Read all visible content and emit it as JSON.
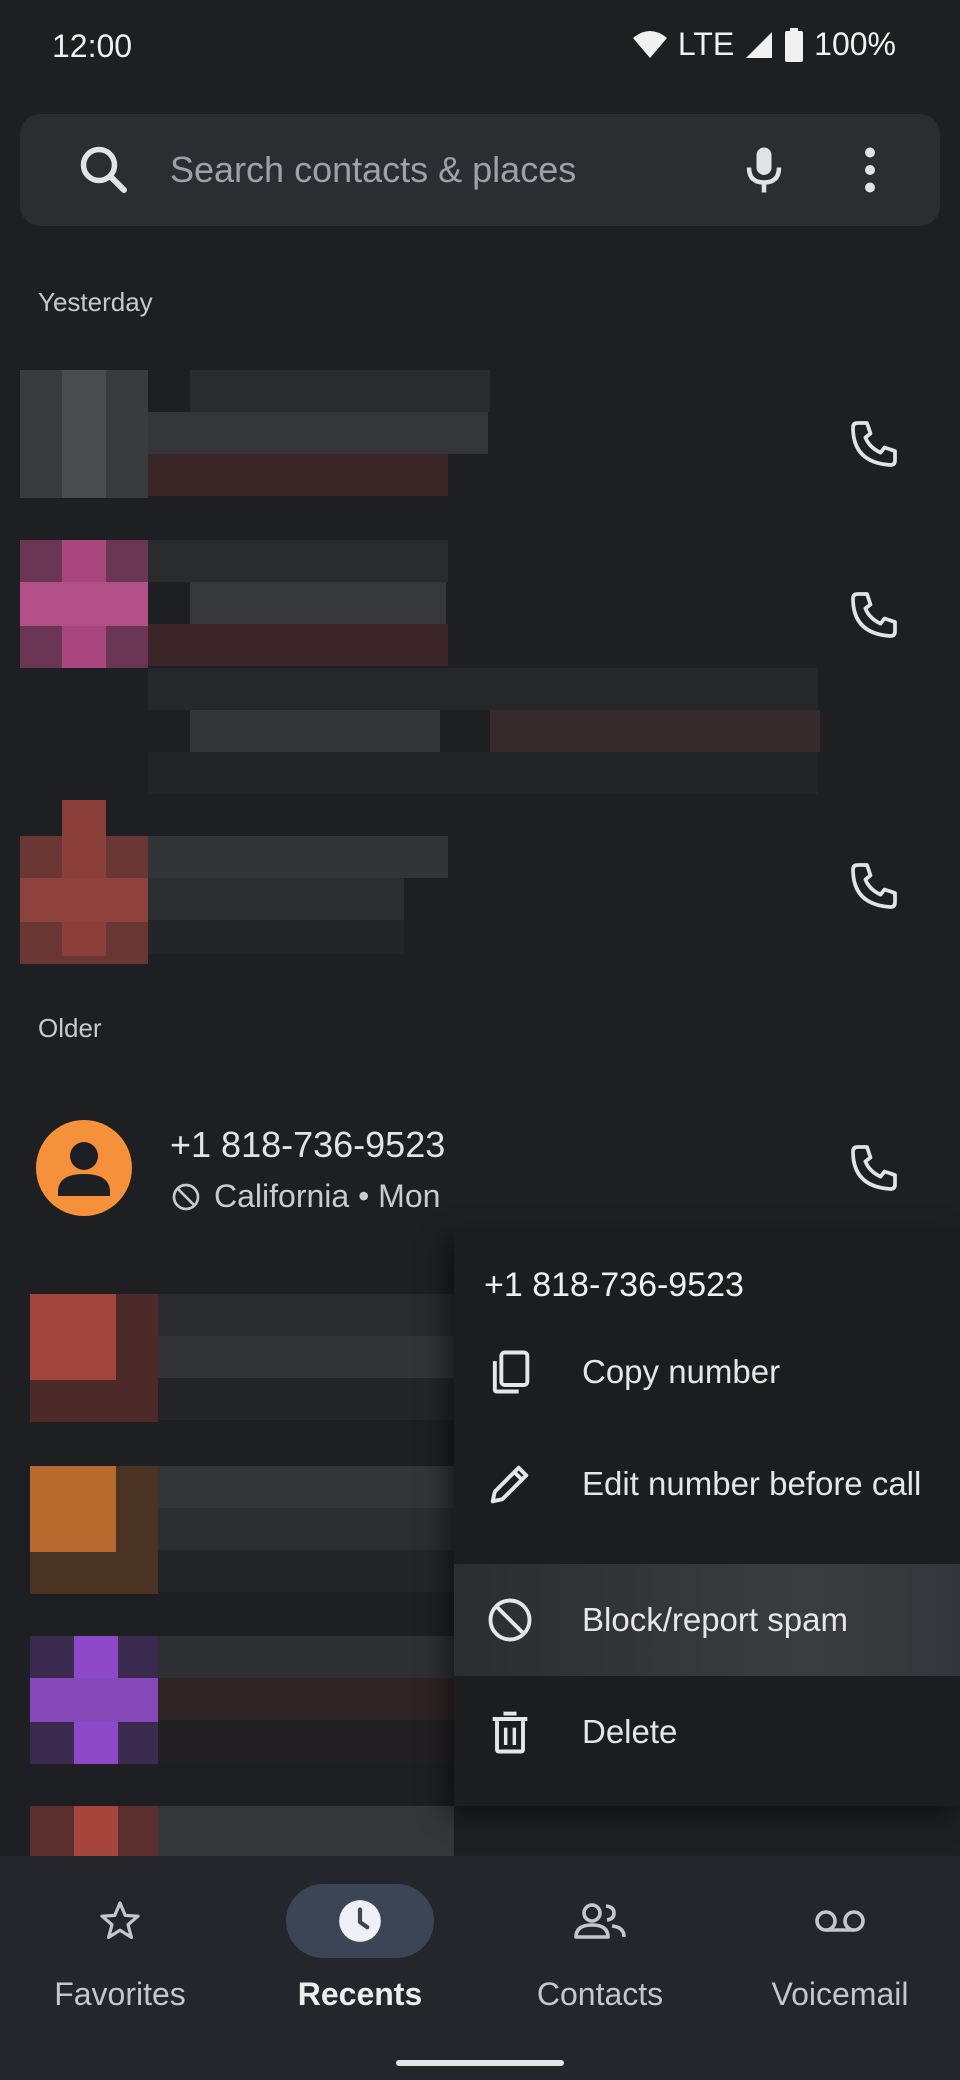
{
  "status_bar": {
    "time": "12:00",
    "network": "LTE",
    "battery": "100%"
  },
  "search": {
    "placeholder": "Search contacts & places"
  },
  "sections": {
    "yesterday": "Yesterday",
    "older": "Older"
  },
  "call_entry": {
    "number": "+1 818-736-9523",
    "subtitle": "California • Mon",
    "avatar_color": "#f5903b"
  },
  "context_menu": {
    "title": "+1 818-736-9523",
    "items": [
      {
        "label": "Copy number",
        "icon": "copy-icon"
      },
      {
        "label": "Edit number before call",
        "icon": "pencil-icon"
      },
      {
        "label": "Block/report spam",
        "icon": "block-icon"
      },
      {
        "label": "Delete",
        "icon": "trash-icon"
      }
    ]
  },
  "bottom_nav": {
    "items": [
      {
        "label": "Favorites",
        "icon": "star-icon"
      },
      {
        "label": "Recents",
        "icon": "clock-icon"
      },
      {
        "label": "Contacts",
        "icon": "people-icon"
      },
      {
        "label": "Voicemail",
        "icon": "voicemail-icon"
      }
    ],
    "active": "Recents"
  }
}
